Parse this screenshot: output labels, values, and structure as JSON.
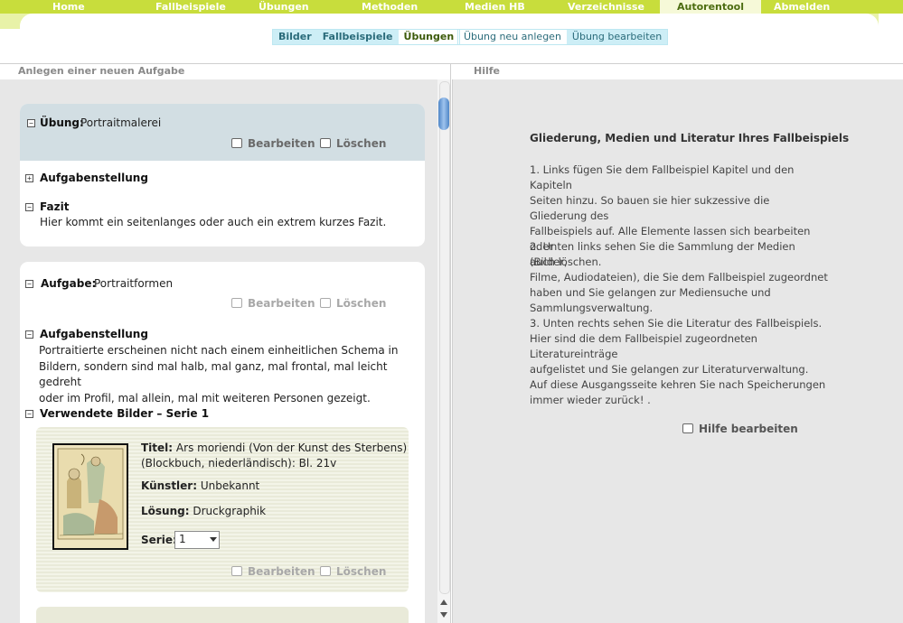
{
  "topnav": {
    "items": [
      "Home",
      "Fallbeispiele",
      "Übungen",
      "Methoden",
      "Medien HB",
      "Verzeichnisse",
      "Autorentool",
      "Abmelden"
    ],
    "active_index": 6
  },
  "subnav": {
    "group1": [
      "Bilder",
      "Fallbeispiele",
      "Übungen"
    ],
    "group1_selected": "Übungen",
    "group2": [
      "Übung neu anlegen",
      "Übung bearbeiten"
    ]
  },
  "left": {
    "title": "Anlegen einer neuen Aufgabe",
    "card1": {
      "type_label": "Übung:",
      "name": "Portraitmalerei",
      "edit": "Bearbeiten",
      "delete": "Löschen",
      "section1": "Aufgabenstellung",
      "section2": "Fazit",
      "fazit_text": "Hier kommt ein seitenlanges oder auch ein extrem kurzes Fazit."
    },
    "card2": {
      "type_label": "Aufgabe:",
      "name": "Portraitformen",
      "edit": "Bearbeiten",
      "delete": "Löschen",
      "section1": "Aufgabenstellung",
      "task_lines": [
        "Portraitierte erscheinen nicht nach einem einheitlichen Schema in",
        "Bildern, sondern sind mal halb, mal ganz, mal frontal, mal leicht gedreht",
        "oder im Profil, mal allein, mal mit weiteren Personen gezeigt."
      ],
      "section2": "Verwendete Bilder – Serie 1",
      "image": {
        "title_label": "Titel:",
        "title_lines": [
          "Ars moriendi (Von der Kunst des Sterbens)",
          "(Blockbuch, niederländisch): Bl. 21v"
        ],
        "artist_label": "Künstler:",
        "artist": "Unbekannt",
        "solution_label": "Lösung:",
        "solution": "Druckgraphik",
        "series_label": "Serie:",
        "series_value": "1",
        "edit": "Bearbeiten",
        "delete": "Löschen"
      }
    }
  },
  "help": {
    "title": "Hilfe",
    "heading": "Gliederung, Medien und Literatur Ihres Fallbeispiels",
    "p1": [
      "1. Links fügen Sie dem Fallbeispiel Kapitel und den Kapiteln",
      "Seiten hinzu. So bauen sie hier sukzessive die Gliederung des",
      "Fallbeispiels auf. Alle Elemente lassen sich bearbeiten oder",
      "auch löschen."
    ],
    "p2": [
      "2. Unten links sehen Sie die Sammlung der Medien (Bilder,",
      "Filme, Audiodateien), die Sie dem Fallbeispiel zugeordnet",
      "haben und Sie gelangen zur Mediensuche und",
      "Sammlungsverwaltung."
    ],
    "p3": [
      "3. Unten rechts sehen Sie die Literatur des Fallbeispiels.",
      "Hier sind die dem Fallbeispiel zugeordneten Literatureinträge",
      "aufgelistet und Sie gelangen zur Literaturverwaltung."
    ],
    "p4": [
      "Auf diese Ausgangsseite kehren Sie nach Speicherungen",
      "immer wieder zurück! ."
    ],
    "edit": "Hilfe bearbeiten"
  },
  "colors": {
    "nav_green": "#c8dd3c",
    "band_green": "#e8f2a8",
    "subnav_blue": "#cdeef6",
    "card_head": "#d2dee3",
    "panel_gray": "#e7e7e7"
  }
}
